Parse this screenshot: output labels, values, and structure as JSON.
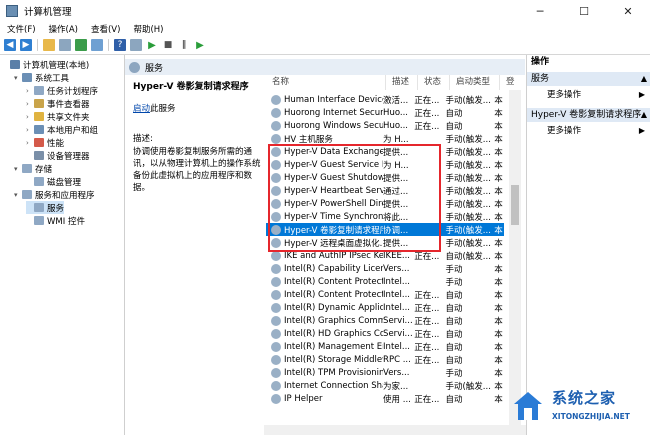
{
  "window": {
    "title": "计算机管理",
    "minimize": "─",
    "maximize": "☐",
    "close": "✕"
  },
  "menu": [
    "文件(F)",
    "操作(A)",
    "查看(V)",
    "帮助(H)"
  ],
  "toolbar": {
    "icons": [
      "back-icon",
      "forward-icon",
      "folder-icon",
      "grid-icon",
      "refresh-icon",
      "export-icon",
      "help-icon",
      "properties-icon",
      "play-icon",
      "stop-icon",
      "pause-icon",
      "restart-icon"
    ],
    "glyphs": [
      "◀",
      "▶",
      "",
      "",
      "",
      "",
      "?",
      "",
      "▶",
      "■",
      "‖",
      "▶"
    ]
  },
  "tree": [
    {
      "label": "计算机管理(本地)",
      "indent": 0,
      "arrow": ""
    },
    {
      "label": "系统工具",
      "indent": 1,
      "arrow": "▾"
    },
    {
      "label": "任务计划程序",
      "indent": 2,
      "arrow": "›"
    },
    {
      "label": "事件查看器",
      "indent": 2,
      "arrow": "›"
    },
    {
      "label": "共享文件夹",
      "indent": 2,
      "arrow": "›"
    },
    {
      "label": "本地用户和组",
      "indent": 2,
      "arrow": "›"
    },
    {
      "label": "性能",
      "indent": 2,
      "arrow": "›"
    },
    {
      "label": "设备管理器",
      "indent": 2,
      "arrow": ""
    },
    {
      "label": "存储",
      "indent": 1,
      "arrow": "▾"
    },
    {
      "label": "磁盘管理",
      "indent": 2,
      "arrow": ""
    },
    {
      "label": "服务和应用程序",
      "indent": 1,
      "arrow": "▾"
    },
    {
      "label": "服务",
      "indent": 2,
      "arrow": "",
      "selected": true
    },
    {
      "label": "WMI 控件",
      "indent": 2,
      "arrow": ""
    }
  ],
  "main": {
    "header": "服务",
    "desc_title": "Hyper-V 卷影复制请求程序",
    "start_link": "启动",
    "start_suffix": "此服务",
    "desc_label": "描述:",
    "desc_text": "协调使用卷影复制服务所需的通讯，以从物理计算机上的操作系统备份此虚拟机上的应用程序和数据。",
    "columns": [
      "名称",
      "描述",
      "状态",
      "启动类型",
      "登"
    ],
    "services": [
      [
        "Human Interface Device ...",
        "激活...",
        "正在...",
        "手动(触发...",
        "本"
      ],
      [
        "Huorong Internet Securit...",
        "Huo...",
        "正在...",
        "自动",
        "本"
      ],
      [
        "Huorong Windows Secur...",
        "Huo...",
        "正在...",
        "自动",
        "本"
      ],
      [
        "HV 主机服务",
        "为 H...",
        "",
        "手动(触发...",
        "本"
      ],
      [
        "Hyper-V Data Exchange ...",
        "提供...",
        "",
        "手动(触发...",
        "本"
      ],
      [
        "Hyper-V Guest Service In...",
        "为 H...",
        "",
        "手动(触发...",
        "本"
      ],
      [
        "Hyper-V Guest Shutdown...",
        "提供...",
        "",
        "手动(触发...",
        "本"
      ],
      [
        "Hyper-V Heartbeat Service",
        "通过...",
        "",
        "手动(触发...",
        "本"
      ],
      [
        "Hyper-V PowerShell Dire...",
        "提供...",
        "",
        "手动(触发...",
        "本"
      ],
      [
        "Hyper-V Time Synchroniz...",
        "将此...",
        "",
        "手动(触发...",
        "本"
      ],
      [
        "Hyper-V 卷影复制请求程序",
        "协调...",
        "",
        "手动(触发...",
        "本"
      ],
      [
        "Hyper-V 远程桌面虚拟化...",
        "提供...",
        "",
        "手动(触发...",
        "本"
      ],
      [
        "IKE and AuthIP IPsec Key...",
        "IKEE...",
        "正在...",
        "自动(触发...",
        "本"
      ],
      [
        "Intel(R) Capability Licensi...",
        "Vers...",
        "",
        "手动",
        "本"
      ],
      [
        "Intel(R) Content Protectio...",
        "Intel...",
        "",
        "手动",
        "本"
      ],
      [
        "Intel(R) Content Protectio...",
        "Intel...",
        "正在...",
        "自动",
        "本"
      ],
      [
        "Intel(R) Dynamic Applicat...",
        "Intel...",
        "正在...",
        "自动",
        "本"
      ],
      [
        "Intel(R) Graphics Comma...",
        "Servi...",
        "正在...",
        "自动",
        "本"
      ],
      [
        "Intel(R) HD Graphics Con...",
        "Servi...",
        "正在...",
        "自动",
        "本"
      ],
      [
        "Intel(R) Management En...",
        "Intel...",
        "正在...",
        "自动",
        "本"
      ],
      [
        "Intel(R) Storage Middlew...",
        "RPC ...",
        "正在...",
        "自动",
        "本"
      ],
      [
        "Intel(R) TPM Provisioning...",
        "Vers...",
        "",
        "手动",
        "本"
      ],
      [
        "Internet Connection Shari...",
        "为家...",
        "",
        "手动(触发...",
        "本"
      ],
      [
        "IP Helper",
        "使用 ...",
        "正在...",
        "自动",
        "本"
      ]
    ],
    "selected_index": 10
  },
  "actions": {
    "header": "操作",
    "groups": [
      {
        "title": "服务",
        "item": "更多操作"
      },
      {
        "title": "Hyper-V 卷影复制请求程序",
        "item": "更多操作"
      }
    ]
  },
  "watermark": {
    "brand": "系统之家",
    "url": "XITONGZHIJIA.NET"
  },
  "colors": {
    "selection": "#0078d7",
    "highlight_box": "#e5262c",
    "header_band": "#e7eef6"
  }
}
